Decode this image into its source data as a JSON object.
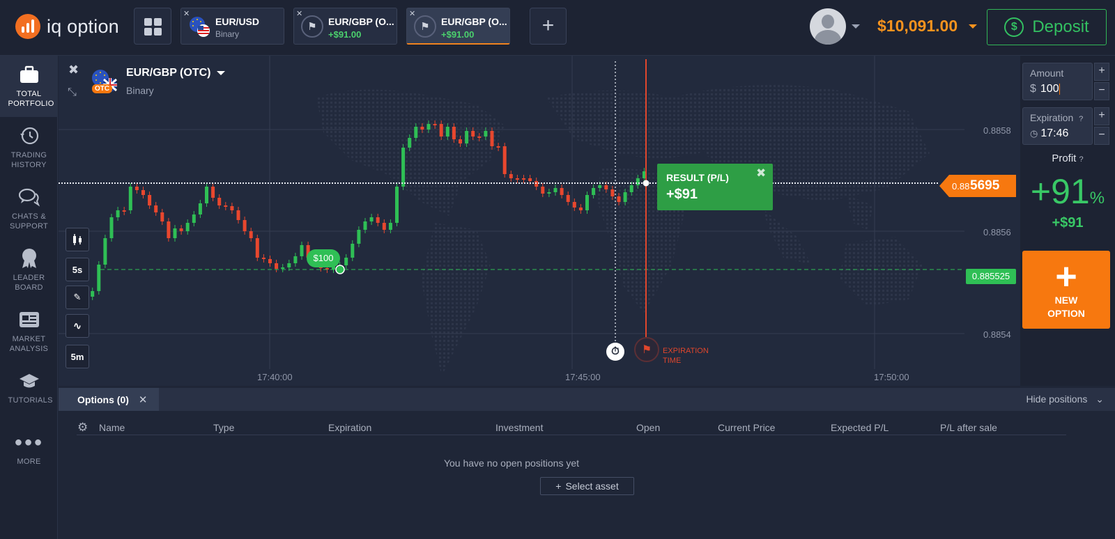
{
  "logo": {
    "text": "iq option"
  },
  "tabs": [
    {
      "name": "EUR/USD",
      "sub": "Binary"
    },
    {
      "name": "EUR/GBP (O...",
      "sub": "+$91.00"
    },
    {
      "name": "EUR/GBP (O...",
      "sub": "+$91.00"
    }
  ],
  "account": {
    "balance": "$10,091.00",
    "deposit_label": "Deposit"
  },
  "sidebar": {
    "items": [
      {
        "label": "TOTAL PORTFOLIO"
      },
      {
        "label": "TRADING HISTORY"
      },
      {
        "label": "CHATS & SUPPORT"
      },
      {
        "label": "LEADER BOARD"
      },
      {
        "label": "MARKET ANALYSIS"
      },
      {
        "label": "TUTORIALS"
      },
      {
        "label": "MORE"
      }
    ]
  },
  "asset": {
    "title": "EUR/GBP (OTC)",
    "type": "Binary",
    "badge": "OTC"
  },
  "chart_tools": {
    "timeframe1": "5s",
    "timeframe2": "5m"
  },
  "chart_data": {
    "type": "candlestick",
    "y_ticks": [
      "0.8858",
      "0.8856",
      "0.8854"
    ],
    "x_ticks": [
      "17:40:00",
      "17:45:00",
      "17:50:00"
    ],
    "current_price": {
      "prefix": "0.88",
      "big": "5695"
    },
    "entry_price": "0.885525",
    "investment_marker": "$100",
    "result": {
      "label": "RESULT (P/L)",
      "value": "+$91"
    },
    "expiration_label": [
      "EXPIRATION",
      "TIME"
    ],
    "colors": {
      "up": "#2fbf55",
      "down": "#e8472e",
      "entry": "#2fbf55",
      "expiration": "#e0462c",
      "current": "#f7780f"
    }
  },
  "trade_panel": {
    "amount_label": "Amount",
    "amount_currency": "$",
    "amount_value": "100",
    "expiration_label": "Expiration",
    "expiration_value": "17:46",
    "profit_label": "Profit",
    "profit_percent": "+91",
    "profit_percent_sign": "%",
    "profit_amount": "+$91",
    "new_option_label_1": "NEW",
    "new_option_label_2": "OPTION"
  },
  "positions": {
    "tab_label": "Options",
    "tab_count": "(0)",
    "hide_label": "Hide positions",
    "columns": [
      "Name",
      "Type",
      "Expiration",
      "Investment",
      "Open",
      "Current Price",
      "Expected P/L",
      "P/L after sale"
    ],
    "empty_message": "You have no open positions yet",
    "select_asset_label": "Select asset"
  }
}
